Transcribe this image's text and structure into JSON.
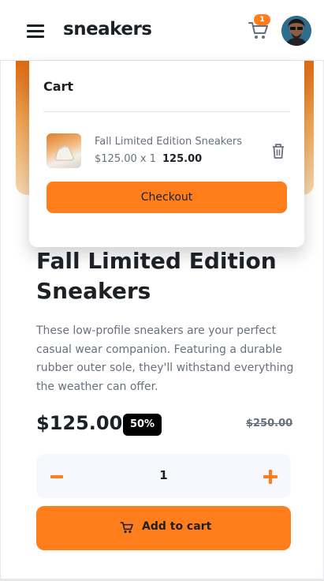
{
  "header": {
    "brand": "sneakers",
    "cart_count": "1",
    "icons": {
      "menu": "hamburger-menu-icon",
      "cart": "cart-icon",
      "avatar": "avatar"
    }
  },
  "cart": {
    "title": "Cart",
    "item": {
      "name": "Fall Limited Edition Sneakers",
      "unit_calc": "$125.00 x 1",
      "total": "125.00"
    },
    "checkout_label": "Checkout"
  },
  "product": {
    "title": "Fall Limited Edition Sneakers",
    "description": "These low-profile sneakers are your perfect casual wear companion. Featuring a durable rubber outer sole, they'll withstand everything the weather can offer.",
    "price": "$125.00",
    "discount": "50%",
    "original_price": "$250.00"
  },
  "quantity": {
    "value": "1"
  },
  "actions": {
    "add_to_cart_label": "Add to cart"
  },
  "colors": {
    "accent": "#ff7e1b",
    "text_dark": "#1d2025",
    "text_muted": "#68707d",
    "qty_bg": "#f6f8fd"
  }
}
